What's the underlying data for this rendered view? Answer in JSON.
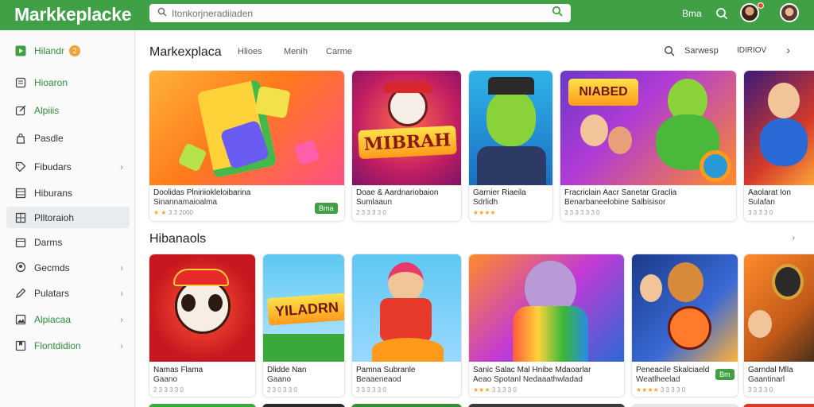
{
  "app": {
    "title": "Markkeplacke",
    "search_placeholder": "Itonkorjneradiiaden",
    "top_label": "Bma"
  },
  "sidebar": {
    "items": [
      {
        "label": "Hilandr",
        "badge": "2",
        "icon": "play-box-icon",
        "green": true
      },
      {
        "label": "Hioaron",
        "icon": "clipboard-icon",
        "green": true
      },
      {
        "label": "Alpiiis",
        "icon": "edit-icon",
        "green": true
      },
      {
        "label": "Pasdle",
        "icon": "bag-icon"
      },
      {
        "label": "Fibudars",
        "icon": "tag-icon",
        "chevron": true
      },
      {
        "label": "Hiburans",
        "icon": "list-icon"
      },
      {
        "label": "Plltoraioh",
        "icon": "grid-icon",
        "active": true
      },
      {
        "label": "Darms",
        "icon": "box-icon"
      },
      {
        "label": "Gecmds",
        "icon": "user-icon",
        "chevron": true
      },
      {
        "label": "Pulatars",
        "icon": "pen-icon",
        "chevron": true
      },
      {
        "label": "Alpiacaa",
        "icon": "image-icon",
        "chevron": true,
        "green": true
      },
      {
        "label": "Flontdidion",
        "icon": "bookmark-icon",
        "chevron": true,
        "green": true
      }
    ]
  },
  "header": {
    "title": "Markexplaca",
    "tabs": [
      "Hlioes",
      "Menih",
      "Carme"
    ],
    "right_label": "Sarwesp",
    "right_dropdown": "IDIRIOV"
  },
  "section2": {
    "title": "Hibanaols"
  },
  "row1": [
    {
      "title": "Doolidas Plniriiokleloibarina",
      "subtitle": "Sinannamaioalma",
      "meta": "3 3 2000",
      "stars": "★ ★",
      "button": "Bma"
    },
    {
      "title": "Doae & Aardnariobaion",
      "subtitle": "Sumlaaun",
      "meta": "2 3 3 3 3 0"
    },
    {
      "title": "Garnier Riaeila",
      "subtitle": "Sdrlidh",
      "meta": "",
      "stars": "★★★★"
    },
    {
      "title": "Fracriclain Aacr Sanetar Graclia",
      "subtitle": "Benarbaneelobine Salbisisor",
      "meta": "3 3 3 3 3 3 0"
    },
    {
      "title": "Aaolarat Ion",
      "subtitle": "Sulafan",
      "meta": "3 3 3 3 0"
    }
  ],
  "row2": [
    {
      "title": "Namas Flama",
      "subtitle": "Gaano",
      "meta": "2 3 3 3 3 0"
    },
    {
      "title": "Dlidde Nan",
      "subtitle": "Gaano",
      "meta": "2 3 0 3 3 0"
    },
    {
      "title": "Pamna Subranle",
      "subtitle": "Beaaeneaod",
      "meta": "3 3 3 3 3 0"
    },
    {
      "title": "Sanic Salac Mal Hnibe Mdaoarlar",
      "subtitle": "Aeao Spotanl Nedaaathwladad",
      "meta": "3 3 3 3 0",
      "stars": "★★★"
    },
    {
      "title": "Peneacile Skalciaeld",
      "subtitle": "Weatlheelad",
      "meta": "3 3 3 3 0",
      "stars": "★★★★",
      "button": "Bm"
    },
    {
      "title": "Garndal Mlla",
      "subtitle": "Gaantinarl",
      "meta": "3 3 3 3 0"
    }
  ],
  "colors": {
    "accent": "#3fa045",
    "star": "#f0a828"
  }
}
